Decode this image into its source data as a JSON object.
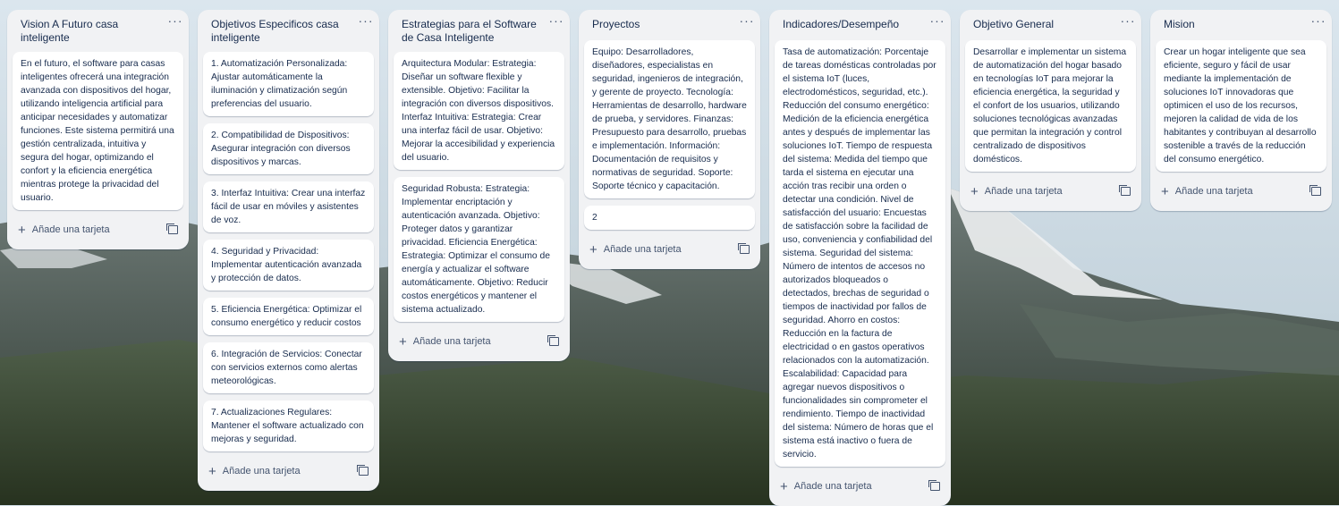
{
  "board": {
    "lists": [
      {
        "title": "Vision A Futuro casa inteligente",
        "cards": [
          "En el futuro, el software para casas inteligentes ofrecerá una integración avanzada con dispositivos del hogar, utilizando inteligencia artificial para anticipar necesidades y automatizar funciones. Este sistema permitirá una gestión centralizada, intuitiva y segura del hogar, optimizando el confort y la eficiencia energética mientras protege la privacidad del usuario."
        ],
        "add_label": "Añade una tarjeta"
      },
      {
        "title": "Objetivos Especificos casa inteligente",
        "cards": [
          "1. Automatización Personalizada: Ajustar automáticamente la iluminación y climatización según preferencias del usuario.",
          "2. Compatibilidad de Dispositivos: Asegurar integración con diversos dispositivos y marcas.",
          "3. Interfaz Intuitiva: Crear una interfaz fácil de usar en móviles y asistentes de voz.",
          "4. Seguridad y Privacidad: Implementar autenticación avanzada y protección de datos.",
          "5. Eficiencia Energética: Optimizar el consumo energético y reducir costos",
          "6. Integración de Servicios: Conectar con servicios externos como alertas meteorológicas.",
          "7. Actualizaciones Regulares: Mantener el software actualizado con mejoras y seguridad."
        ],
        "add_label": "Añade una tarjeta"
      },
      {
        "title": "Estrategias para el Software de Casa Inteligente",
        "cards": [
          "Arquitectura Modular: Estrategia: Diseñar un software flexible y extensible. Objetivo: Facilitar la integración con diversos dispositivos. Interfaz Intuitiva: Estrategia: Crear una interfaz fácil de usar. Objetivo: Mejorar la accesibilidad y experiencia del usuario.",
          "Seguridad Robusta: Estrategia: Implementar encriptación y autenticación avanzada. Objetivo: Proteger datos y garantizar privacidad. Eficiencia Energética: Estrategia: Optimizar el consumo de energía y actualizar el software automáticamente. Objetivo: Reducir costos energéticos y mantener el sistema actualizado."
        ],
        "add_label": "Añade una tarjeta"
      },
      {
        "title": "Proyectos",
        "cards": [
          "Equipo: Desarrolladores, diseñadores, especialistas en seguridad, ingenieros de integración, y gerente de proyecto. Tecnología: Herramientas de desarrollo, hardware de prueba, y servidores. Finanzas: Presupuesto para desarrollo, pruebas e implementación. Información: Documentación de requisitos y normativas de seguridad. Soporte: Soporte técnico y capacitación.",
          "2"
        ],
        "add_label": "Añade una tarjeta"
      },
      {
        "title": "Indicadores/Desempeño",
        "cards": [
          "Tasa de automatización: Porcentaje de tareas domésticas controladas por el sistema IoT (luces, electrodomésticos, seguridad, etc.). Reducción del consumo energético: Medición de la eficiencia energética antes y después de implementar las soluciones IoT. Tiempo de respuesta del sistema: Medida del tiempo que tarda el sistema en ejecutar una acción tras recibir una orden o detectar una condición. Nivel de satisfacción del usuario: Encuestas de satisfacción sobre la facilidad de uso, conveniencia y confiabilidad del sistema. Seguridad del sistema: Número de intentos de accesos no autorizados bloqueados o detectados, brechas de seguridad o tiempos de inactividad por fallos de seguridad. Ahorro en costos: Reducción en la factura de electricidad o en gastos operativos relacionados con la automatización. Escalabilidad: Capacidad para agregar nuevos dispositivos o funcionalidades sin comprometer el rendimiento. Tiempo de inactividad del sistema: Número de horas que el sistema está inactivo o fuera de servicio."
        ],
        "add_label": "Añade una tarjeta"
      },
      {
        "title": "Objetivo General",
        "cards": [
          "Desarrollar e implementar un sistema de automatización del hogar basado en tecnologías IoT para mejorar la eficiencia energética, la seguridad y el confort de los usuarios, utilizando soluciones tecnológicas avanzadas que permitan la integración y control centralizado de dispositivos domésticos."
        ],
        "add_label": "Añade una tarjeta"
      },
      {
        "title": "Mision",
        "cards": [
          "Crear un hogar inteligente que sea eficiente, seguro y fácil de usar mediante la implementación de soluciones IoT innovadoras que optimicen el uso de los recursos, mejoren la calidad de vida de los habitantes y contribuyan al desarrollo sostenible a través de la reducción del consumo energético."
        ],
        "add_label": "Añade una tarjeta"
      }
    ]
  },
  "icons": {
    "menu": "more-horizontal-icon",
    "add": "plus-icon",
    "template": "card-template-icon"
  },
  "colors": {
    "list_bg": "#f1f2f4",
    "card_bg": "#ffffff",
    "text": "#172b4d",
    "muted": "#44546f"
  }
}
